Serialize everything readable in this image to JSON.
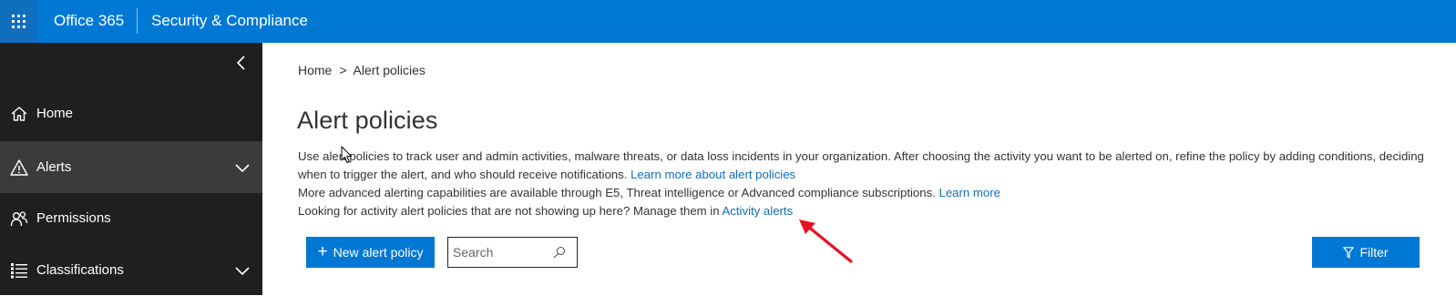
{
  "header": {
    "app_name": "Office 365",
    "product_name": "Security & Compliance",
    "background_color": "#0078d4",
    "waffle_icon": "app-launcher-icon"
  },
  "sidebar": {
    "background_color": "#1f1f1f",
    "collapse_icon": "chevron-left-icon",
    "items": [
      {
        "label": "Home",
        "icon": "home-icon",
        "expandable": false,
        "active": false
      },
      {
        "label": "Alerts",
        "icon": "warning-icon",
        "expandable": true,
        "active": true
      },
      {
        "label": "Permissions",
        "icon": "people-icon",
        "expandable": false,
        "active": false
      },
      {
        "label": "Classifications",
        "icon": "list-icon",
        "expandable": true,
        "active": false
      }
    ]
  },
  "breadcrumb": {
    "home": "Home",
    "separator": ">",
    "current": "Alert policies"
  },
  "page": {
    "title": "Alert policies",
    "description_line1": "Use alert policies to track user and admin activities, malware threats, or data loss incidents in your organization. After choosing the activity you want to be alerted on, refine the policy by adding conditions, deciding when to trigger the alert, and who should receive notifications.",
    "learn_more_alerts_link": "Learn more about alert policies",
    "description_line2": "More advanced alerting capabilities are available through E5, Threat intelligence or Advanced compliance subscriptions.",
    "learn_more_link": "Learn more",
    "description_line3": "Looking for activity alert policies that are not showing up here? Manage them in",
    "activity_alerts_link": "Activity alerts",
    "link_color": "#106ebe"
  },
  "toolbar": {
    "new_policy_label": "New alert policy",
    "search_placeholder": "Search",
    "filter_label": "Filter",
    "button_color": "#0078d4"
  },
  "annotation": {
    "arrow_color": "#e81123"
  }
}
